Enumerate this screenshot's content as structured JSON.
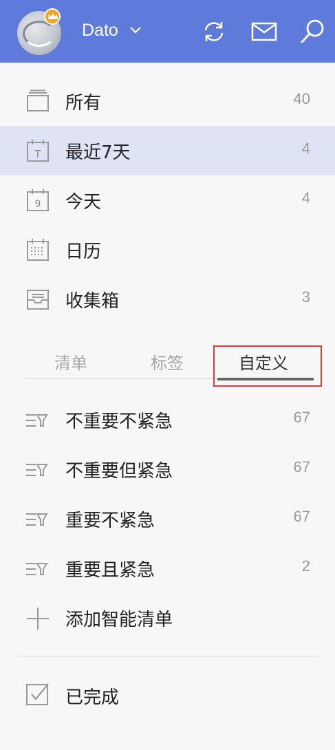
{
  "header": {
    "username": "Dato",
    "icons": [
      "sync-icon",
      "mail-icon",
      "search-icon"
    ]
  },
  "smart_lists": [
    {
      "label": "所有",
      "count": "40",
      "icon": "all-icon"
    },
    {
      "label": "最近7天",
      "count": "4",
      "icon": "calendar-t-icon",
      "selected": true
    },
    {
      "label": "今天",
      "count": "4",
      "icon": "calendar-today-icon"
    },
    {
      "label": "日历",
      "count": "",
      "icon": "calendar-grid-icon"
    },
    {
      "label": "收集箱",
      "count": "3",
      "icon": "inbox-icon"
    }
  ],
  "tabs": [
    {
      "label": "清单"
    },
    {
      "label": "标签"
    },
    {
      "label": "自定义",
      "active": true
    }
  ],
  "custom_filters": [
    {
      "label": "不重要不紧急",
      "count": "67"
    },
    {
      "label": "不重要但紧急",
      "count": "67"
    },
    {
      "label": "重要不紧急",
      "count": "67"
    },
    {
      "label": "重要且紧急",
      "count": "2"
    }
  ],
  "add_filter_label": "添加智能清单",
  "completed_label": "已完成",
  "colors": {
    "header": "#5e7bdb",
    "selected_row": "#dfe4f4",
    "highlight": "#e03a3a",
    "crown": "#f2a426"
  }
}
